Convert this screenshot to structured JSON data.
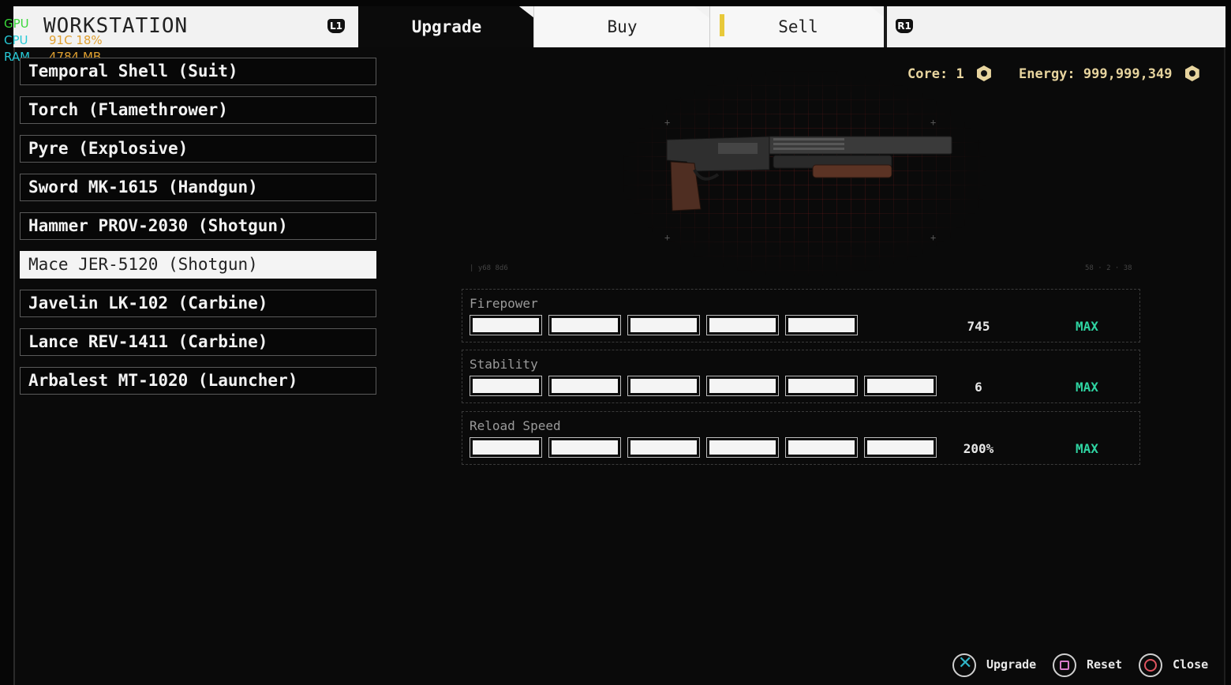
{
  "overlay": {
    "gpu_label": "GPU",
    "gpu_value": "",
    "cpu_label": "CPU",
    "cpu_value": "91C 18%",
    "ram_label": "RAM",
    "ram_value": "4784 MB"
  },
  "header": {
    "title": "WORKSTATION",
    "left_shoulder": "L1",
    "right_shoulder": "R1",
    "tabs": [
      {
        "label": "Upgrade",
        "active": true
      },
      {
        "label": "Buy",
        "active": false
      },
      {
        "label": "Sell",
        "active": false
      }
    ]
  },
  "weapons": [
    {
      "label": "Temporal Shell (Suit)",
      "selected": false
    },
    {
      "label": "Torch (Flamethrower)",
      "selected": false
    },
    {
      "label": "Pyre (Explosive)",
      "selected": false
    },
    {
      "label": "Sword MK-1615 (Handgun)",
      "selected": false
    },
    {
      "label": "Hammer PROV-2030 (Shotgun)",
      "selected": false
    },
    {
      "label": "Mace JER-5120 (Shotgun)",
      "selected": true
    },
    {
      "label": "Javelin LK-102 (Carbine)",
      "selected": false
    },
    {
      "label": "Lance REV-1411 (Carbine)",
      "selected": false
    },
    {
      "label": "Arbalest MT-1020 (Launcher)",
      "selected": false
    }
  ],
  "currency": {
    "core_label": "Core:",
    "core_value": "1",
    "energy_label": "Energy:",
    "energy_value": "999,999,349"
  },
  "stats": [
    {
      "label": "Firepower",
      "level": 5,
      "max_level": 5,
      "value": "745",
      "status": "MAX"
    },
    {
      "label": "Stability",
      "level": 6,
      "max_level": 6,
      "value": "6",
      "status": "MAX"
    },
    {
      "label": "Reload Speed",
      "level": 6,
      "max_level": 6,
      "value": "200%",
      "status": "MAX"
    }
  ],
  "footer": {
    "upgrade_label": "Upgrade",
    "reset_label": "Reset",
    "close_label": "Close"
  },
  "colors": {
    "accent_max": "#2fd4a2",
    "currency": "#e7d49e",
    "sell_alert": "#e8c93a"
  }
}
